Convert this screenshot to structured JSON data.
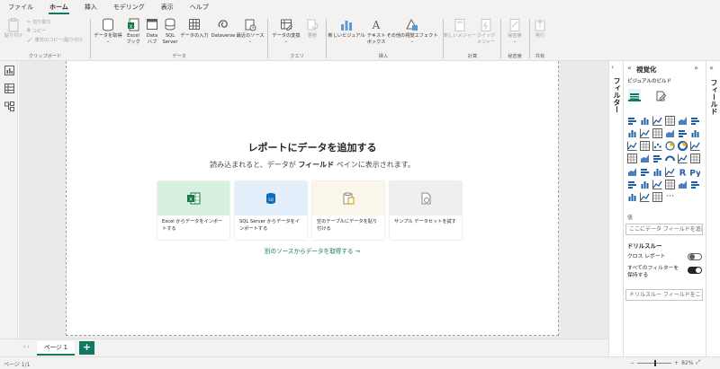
{
  "menu": {
    "tabs": [
      "ファイル",
      "ホーム",
      "挿入",
      "モデリング",
      "表示",
      "ヘルプ"
    ],
    "active": "ホーム"
  },
  "ribbon": {
    "clipboard": {
      "paste": "貼り付け",
      "cut": "切り取り",
      "copy": "コピー",
      "format_painter": "書式のコピー/貼り付け",
      "group": "クリップボード"
    },
    "data": {
      "get_data": "データを取得",
      "excel": "Excel ブック",
      "datahub": "Data ハブ",
      "sql": "SQL Server",
      "enter_data": "データの入力",
      "dataverse": "Dataverse",
      "recent": "最近のソース",
      "group": "データ"
    },
    "queries": {
      "transform": "データの変換",
      "refresh": "更新",
      "group": "クエリ"
    },
    "insert": {
      "new_visual": "新しいビジュアル",
      "textbox": "テキスト ボックス",
      "more_visuals": "その他の視覚エフェクト",
      "group": "挿入"
    },
    "calc": {
      "new_measure": "新しいメジャー",
      "quick_measure": "クイック メジャー",
      "group": "計算"
    },
    "sensitivity": {
      "label": "秘密度",
      "group": "秘密度"
    },
    "share": {
      "publish": "発行",
      "group": "共有"
    }
  },
  "canvas": {
    "title": "レポートにデータを追加する",
    "subtitle_pre": "読み込まれると、データが ",
    "subtitle_bold": "フィールド",
    "subtitle_post": " ペインに表示されます。",
    "cards": [
      {
        "label": "Excel からデータをインポートする",
        "bg": "#d8f0e0"
      },
      {
        "label": "SQL Server からデータをインポートする",
        "bg": "#e3effb"
      },
      {
        "label": "空のテーブルにデータを貼り付ける",
        "bg": "#fbf6ea"
      },
      {
        "label": "サンプル データセットを試す",
        "bg": "#efefef"
      }
    ],
    "other_sources": "別のソースからデータを取得する →"
  },
  "pages": {
    "tab": "ページ 1",
    "add": "+"
  },
  "status": {
    "page": "ページ 1/1",
    "zoom": "82%",
    "zoom_level": 0.82
  },
  "filters": {
    "label": "フィルター"
  },
  "viz": {
    "title": "視覚化",
    "subtitle": "ビジュアルのビルド",
    "values_label": "値",
    "values_placeholder": "ここにデータ フィールドを追加",
    "drill_title": "ドリルスルー",
    "cross_report": "クロス レポート",
    "cross_report_on": false,
    "keep_filters": "すべてのフィルターを保持する",
    "keep_filters_on": true,
    "drill_placeholder": "ドリルスルー フィールドをここに追加",
    "accent": "#117865"
  },
  "fields": {
    "label": "フィールド"
  }
}
